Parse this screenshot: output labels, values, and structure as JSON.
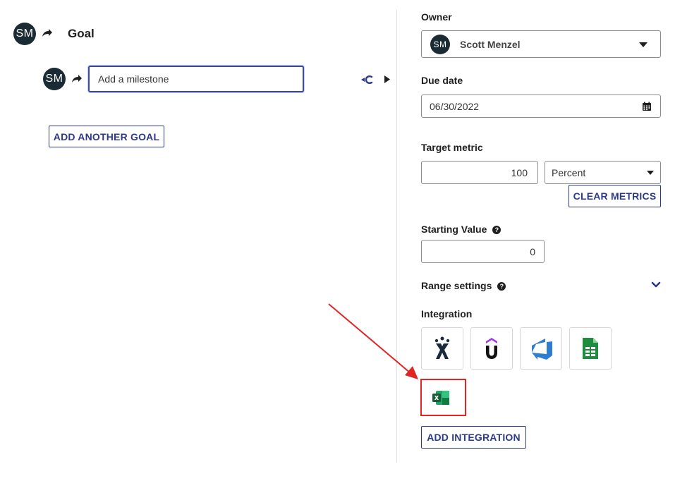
{
  "goal": {
    "avatar_initials": "SM",
    "title": "Goal",
    "milestone_avatar_initials": "SM",
    "milestone_placeholder": "Add a milestone",
    "add_another_goal_label": "ADD ANOTHER GOAL"
  },
  "panel": {
    "owner_label": "Owner",
    "owner_initials": "SM",
    "owner_name": "Scott Menzel",
    "due_date_label": "Due date",
    "due_date_value": "06/30/2022",
    "target_metric_label": "Target metric",
    "target_value": "100",
    "target_unit": "Percent",
    "clear_metrics_label": "CLEAR METRICS",
    "starting_value_label": "Starting Value",
    "starting_value": "0",
    "range_settings_label": "Range settings",
    "integration_label": "Integration",
    "add_integration_label": "ADD INTEGRATION"
  },
  "integrations": [
    {
      "name": "jira",
      "icon": "jira-icon",
      "color": "#1b2a3a"
    },
    {
      "name": "udemy",
      "icon": "udemy-icon",
      "color": "#a435f0"
    },
    {
      "name": "azure-devops",
      "icon": "azure-devops-icon",
      "color": "#2f7cd3"
    },
    {
      "name": "google-sheets",
      "icon": "google-sheets-icon",
      "color": "#1e8e3e"
    },
    {
      "name": "excel",
      "icon": "excel-icon",
      "color": "#1d6f42"
    }
  ],
  "colors": {
    "accent": "#2d3a8c",
    "avatar_bg": "#1a2b33",
    "annotation": "#e02525"
  }
}
